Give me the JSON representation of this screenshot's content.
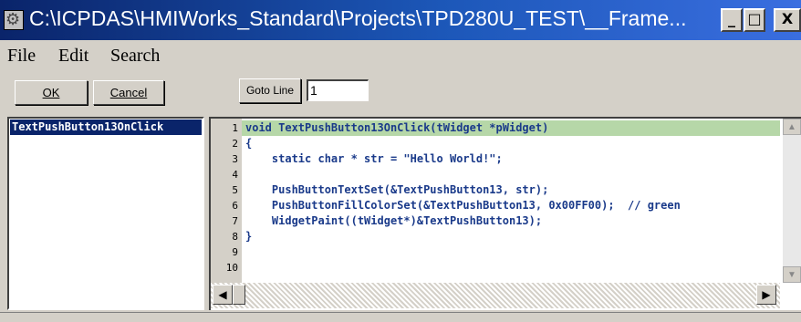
{
  "window": {
    "title": "C:\\ICPDAS\\HMIWorks_Standard\\Projects\\TPD280U_TEST\\__Frame...",
    "icon": "gear-icon",
    "minimize_symbol": "_",
    "maximize_symbol": "□",
    "close_symbol": "X"
  },
  "menu": {
    "items": [
      "File",
      "Edit",
      "Search"
    ]
  },
  "toolbar": {
    "ok_label": "OK",
    "cancel_label": "Cancel",
    "goto_label": "Goto Line",
    "goto_value": "1"
  },
  "function_list": {
    "items": [
      "TextPushButton13OnClick"
    ]
  },
  "editor": {
    "highlight_color": "#b6d7a8",
    "lines": [
      {
        "num": "1",
        "text": "void TextPushButton13OnClick(tWidget *pWidget)"
      },
      {
        "num": "2",
        "text": "{"
      },
      {
        "num": "3",
        "text": "    static char * str = \"Hello World!\";"
      },
      {
        "num": "4",
        "text": ""
      },
      {
        "num": "5",
        "text": "    PushButtonTextSet(&TextPushButton13, str);"
      },
      {
        "num": "6",
        "text": "    PushButtonFillColorSet(&TextPushButton13, 0x00FF00);  // green"
      },
      {
        "num": "7",
        "text": "    WidgetPaint((tWidget*)&TextPushButton13);"
      },
      {
        "num": "8",
        "text": "}"
      },
      {
        "num": "9",
        "text": ""
      },
      {
        "num": "10",
        "text": ""
      }
    ]
  },
  "scroll": {
    "left_arrow": "◀",
    "right_arrow": "▶",
    "up_arrow": "▲",
    "down_arrow": "▼"
  }
}
